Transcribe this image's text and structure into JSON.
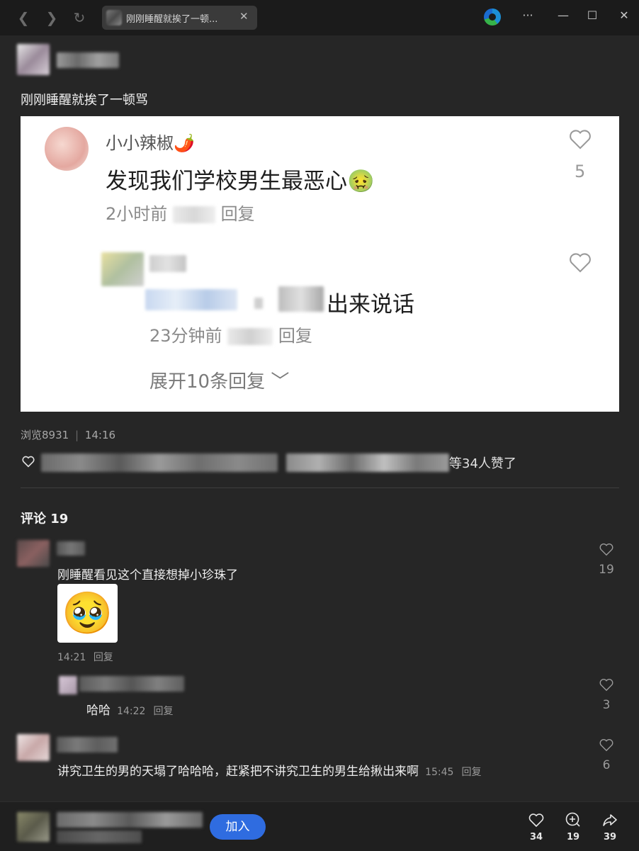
{
  "browser": {
    "tab_title": "刚刚睡醒就挨了一顿...",
    "tab_close": "✕"
  },
  "post": {
    "title": "刚刚睡醒就挨了一顿骂"
  },
  "screenshot": {
    "commenter_name": "小小辣椒🌶️",
    "comment_text": "发现我们学校男生最恶心🤢",
    "comment_time": "2小时前",
    "comment_reply": "回复",
    "comment_likes": "5",
    "reply_text_tail": "出来说话",
    "reply_time": "23分钟前",
    "reply_reply": "回复",
    "expand_label": "展开10条回复 ﹀"
  },
  "stats": {
    "views": "浏览8931",
    "time": "14:16"
  },
  "likes_line_tail": "等34人赞了",
  "comments_header": "评论 19",
  "comments": [
    {
      "text": "刚睡醒看见这个直接想掉小珍珠了",
      "emoji": "🥹",
      "time": "14:21",
      "reply": "回复",
      "likes": "19"
    },
    {
      "text": "哈哈",
      "time": "14:22",
      "reply": "回复",
      "likes": "3"
    },
    {
      "text": "讲究卫生的男的天塌了哈哈哈，赶紧把不讲究卫生的男生给揪出来啊",
      "time": "15:45",
      "reply": "回复",
      "likes": "6"
    }
  ],
  "bottom": {
    "join_label": "加入",
    "likes": "34",
    "comments": "19",
    "shares": "39"
  },
  "colors": {
    "accent": "#2f6ce0",
    "background": "#262626",
    "titlebar": "#1b1b1b"
  }
}
